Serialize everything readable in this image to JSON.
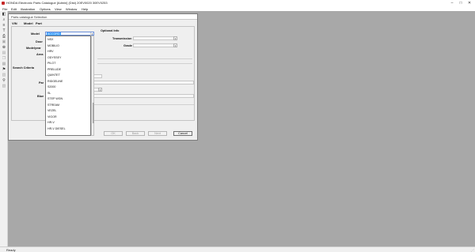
{
  "window": {
    "title": "HONDA Electronic Parts Catalogue [Admin] (Dist) 20EV0020 30EV0253"
  },
  "menu": [
    "File",
    "Edit",
    "Illustration",
    "Options",
    "View",
    "Window",
    "Help"
  ],
  "dialog": {
    "title": "Parts catalogue Selection",
    "tabs": [
      "VIN",
      "Model",
      "Part"
    ],
    "labels": {
      "model": "Model",
      "door": "Door",
      "model_year": "Modelyear",
      "area": "Area",
      "optional_info": "Optional Info",
      "transmission": "Transmission",
      "grade": "Grade",
      "search_criteria": "Search Criteria",
      "par": "Par",
      "blue": "Blue"
    },
    "model_value": "ACCORD",
    "dropdown_items": [
      "NSX",
      "MOBILIO",
      "HRV",
      "ODYSSEY",
      "PILOT",
      "PRELUDE",
      "QUINTET",
      "RIDGELINE",
      "S2000",
      "SL",
      "STEP WGN",
      "STREAM",
      "VEZEL",
      "VIGOR",
      "HR-V",
      "HR-V DIESEL"
    ],
    "buttons": {
      "ok": "OK",
      "back": "Back",
      "next": "Next",
      "cancel": "Cancel"
    }
  },
  "status": {
    "text": "Ready"
  }
}
